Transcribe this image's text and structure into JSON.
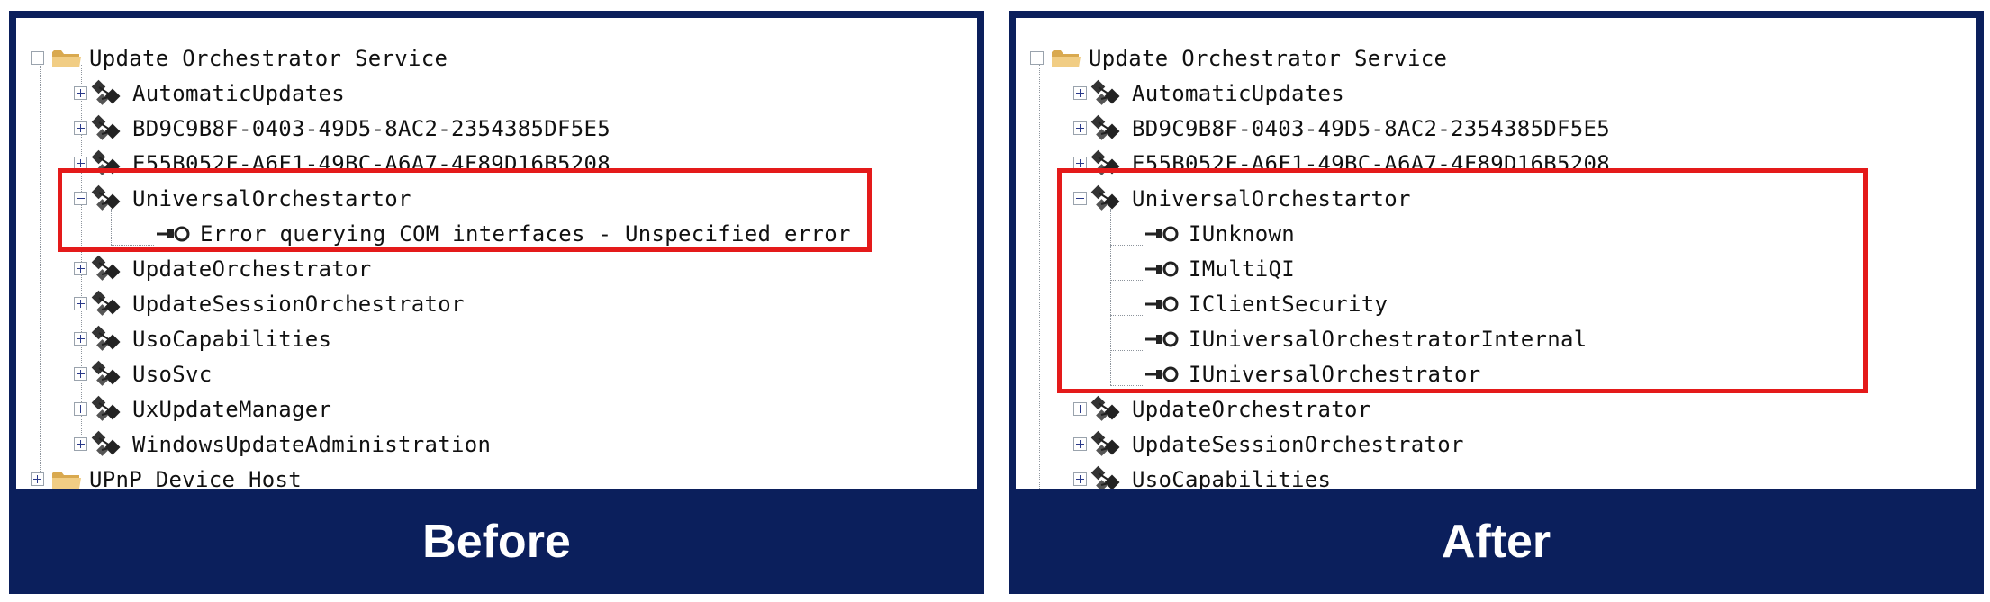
{
  "panels": {
    "before": {
      "caption": "Before",
      "service_top": "Update Orchestrator Service",
      "children": [
        {
          "label": "AutomaticUpdates"
        },
        {
          "label": "BD9C9B8F-0403-49D5-8AC2-2354385DF5E5"
        },
        {
          "label": "E55B052F-A6F1-49BC-A6A7-4F89D16B5208"
        },
        {
          "label": "UniversalOrchestartor"
        },
        {
          "label": "UpdateOrchestrator"
        },
        {
          "label": "UpdateSessionOrchestrator"
        },
        {
          "label": "UsoCapabilities"
        },
        {
          "label": "UsoSvc"
        },
        {
          "label": "UxUpdateManager"
        },
        {
          "label": "WindowsUpdateAdministration"
        }
      ],
      "error_text": "Error querying COM interfaces - Unspecified error",
      "service_next": "UPnP Device Host"
    },
    "after": {
      "caption": "After",
      "service_top": "Update Orchestrator Service",
      "children": [
        {
          "label": "AutomaticUpdates"
        },
        {
          "label": "BD9C9B8F-0403-49D5-8AC2-2354385DF5E5"
        },
        {
          "label": "E55B052F-A6F1-49BC-A6A7-4F89D16B5208"
        },
        {
          "label": "UniversalOrchestartor"
        },
        {
          "label": "UpdateOrchestrator"
        },
        {
          "label": "UpdateSessionOrchestrator"
        },
        {
          "label": "UsoCapabilities"
        }
      ],
      "interfaces": [
        {
          "label": "IUnknown"
        },
        {
          "label": "IMultiQI"
        },
        {
          "label": "IClientSecurity"
        },
        {
          "label": "IUniversalOrchestratorInternal"
        },
        {
          "label": "IUniversalOrchestrator"
        }
      ]
    }
  },
  "colors": {
    "frame": "#0b1f5c",
    "highlight": "#e41a1a",
    "folder": "#e9c070"
  }
}
